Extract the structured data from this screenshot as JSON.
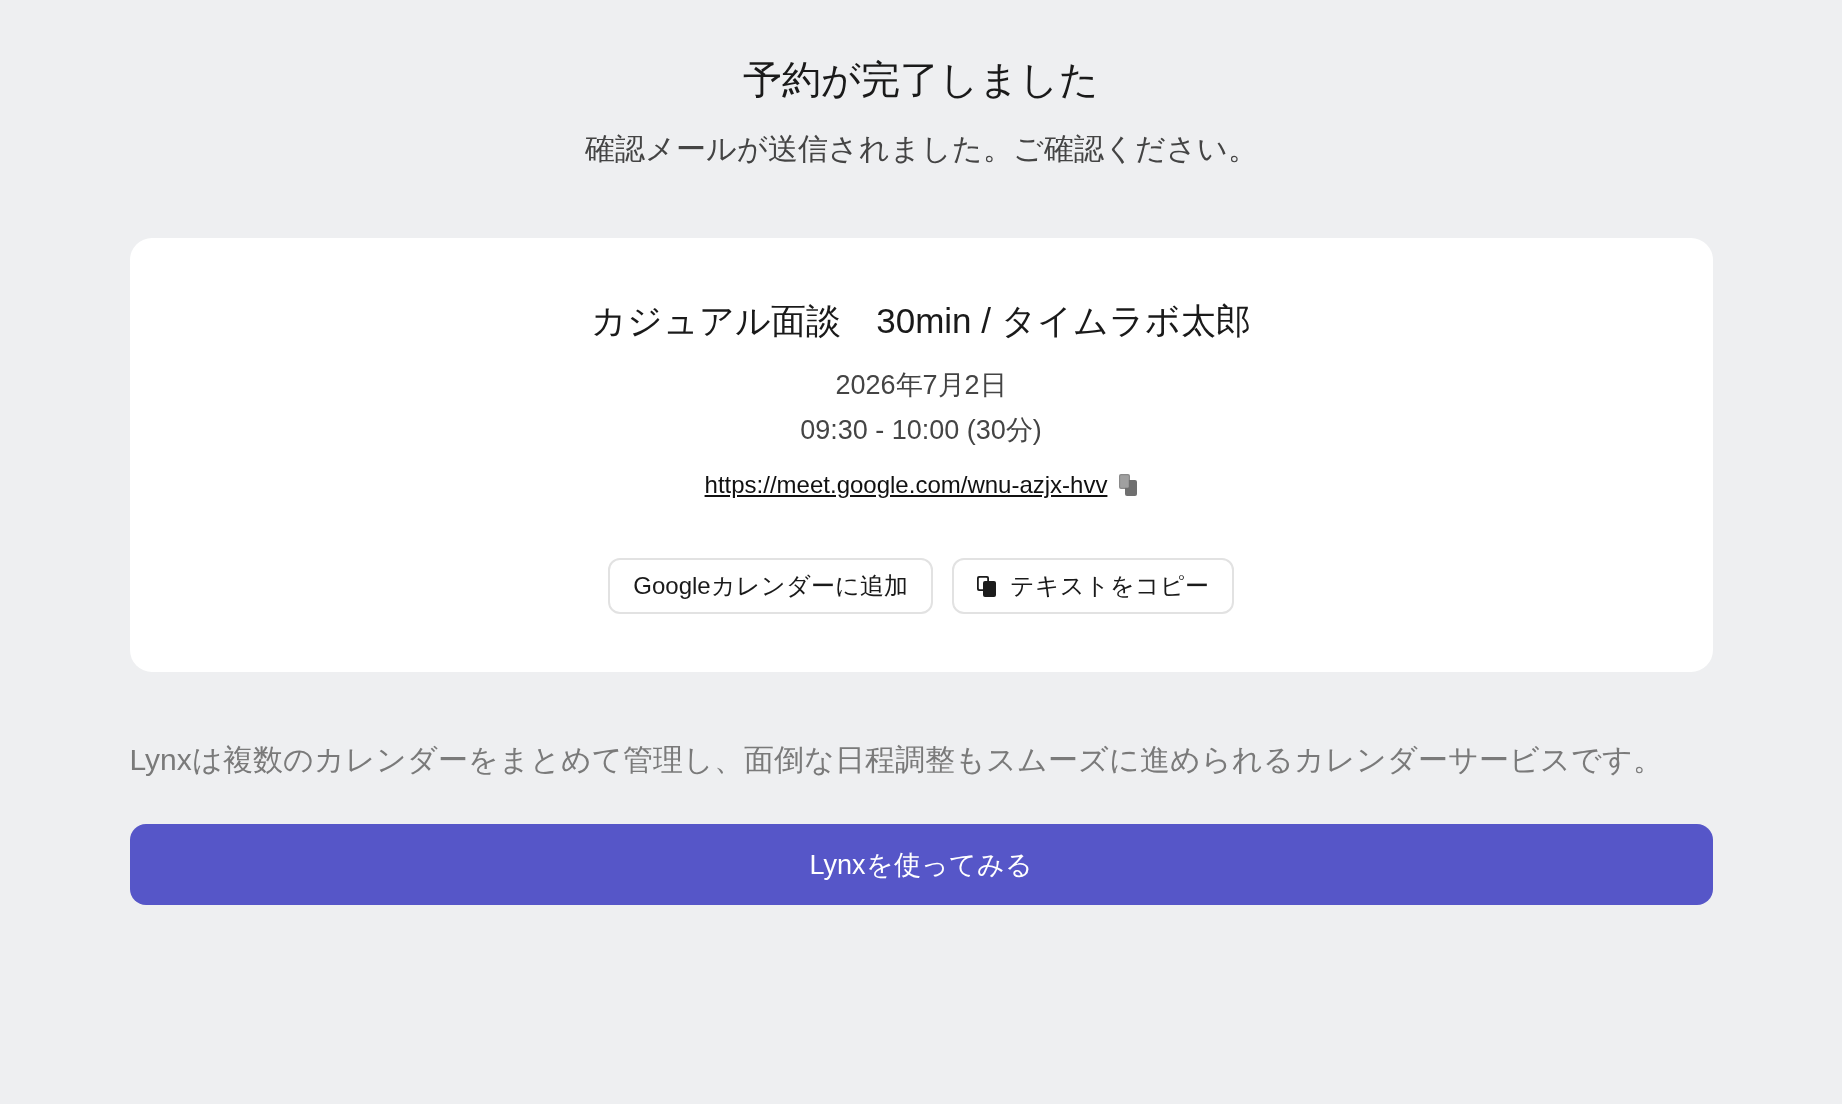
{
  "header": {
    "title": "予約が完了しました",
    "subtitle": "確認メールが送信されました。ご確認ください。"
  },
  "booking_card": {
    "title": "カジュアル面談　30min / タイムラボ太郎",
    "date": "2026年7月2日",
    "time": "09:30 - 10:00 (30分)",
    "meeting_link": "https://meet.google.com/wnu-azjx-hvv",
    "buttons": [
      {
        "label": "Googleカレンダーに追加",
        "kind": "plain"
      },
      {
        "label": "テキストをコピー",
        "kind": "copy"
      }
    ]
  },
  "promo": {
    "description": "Lynxは複数のカレンダーをまとめて管理し、面倒な日程調整もスムーズに進められるカレンダーサービスです。",
    "button": "Lynxを使ってみる"
  }
}
